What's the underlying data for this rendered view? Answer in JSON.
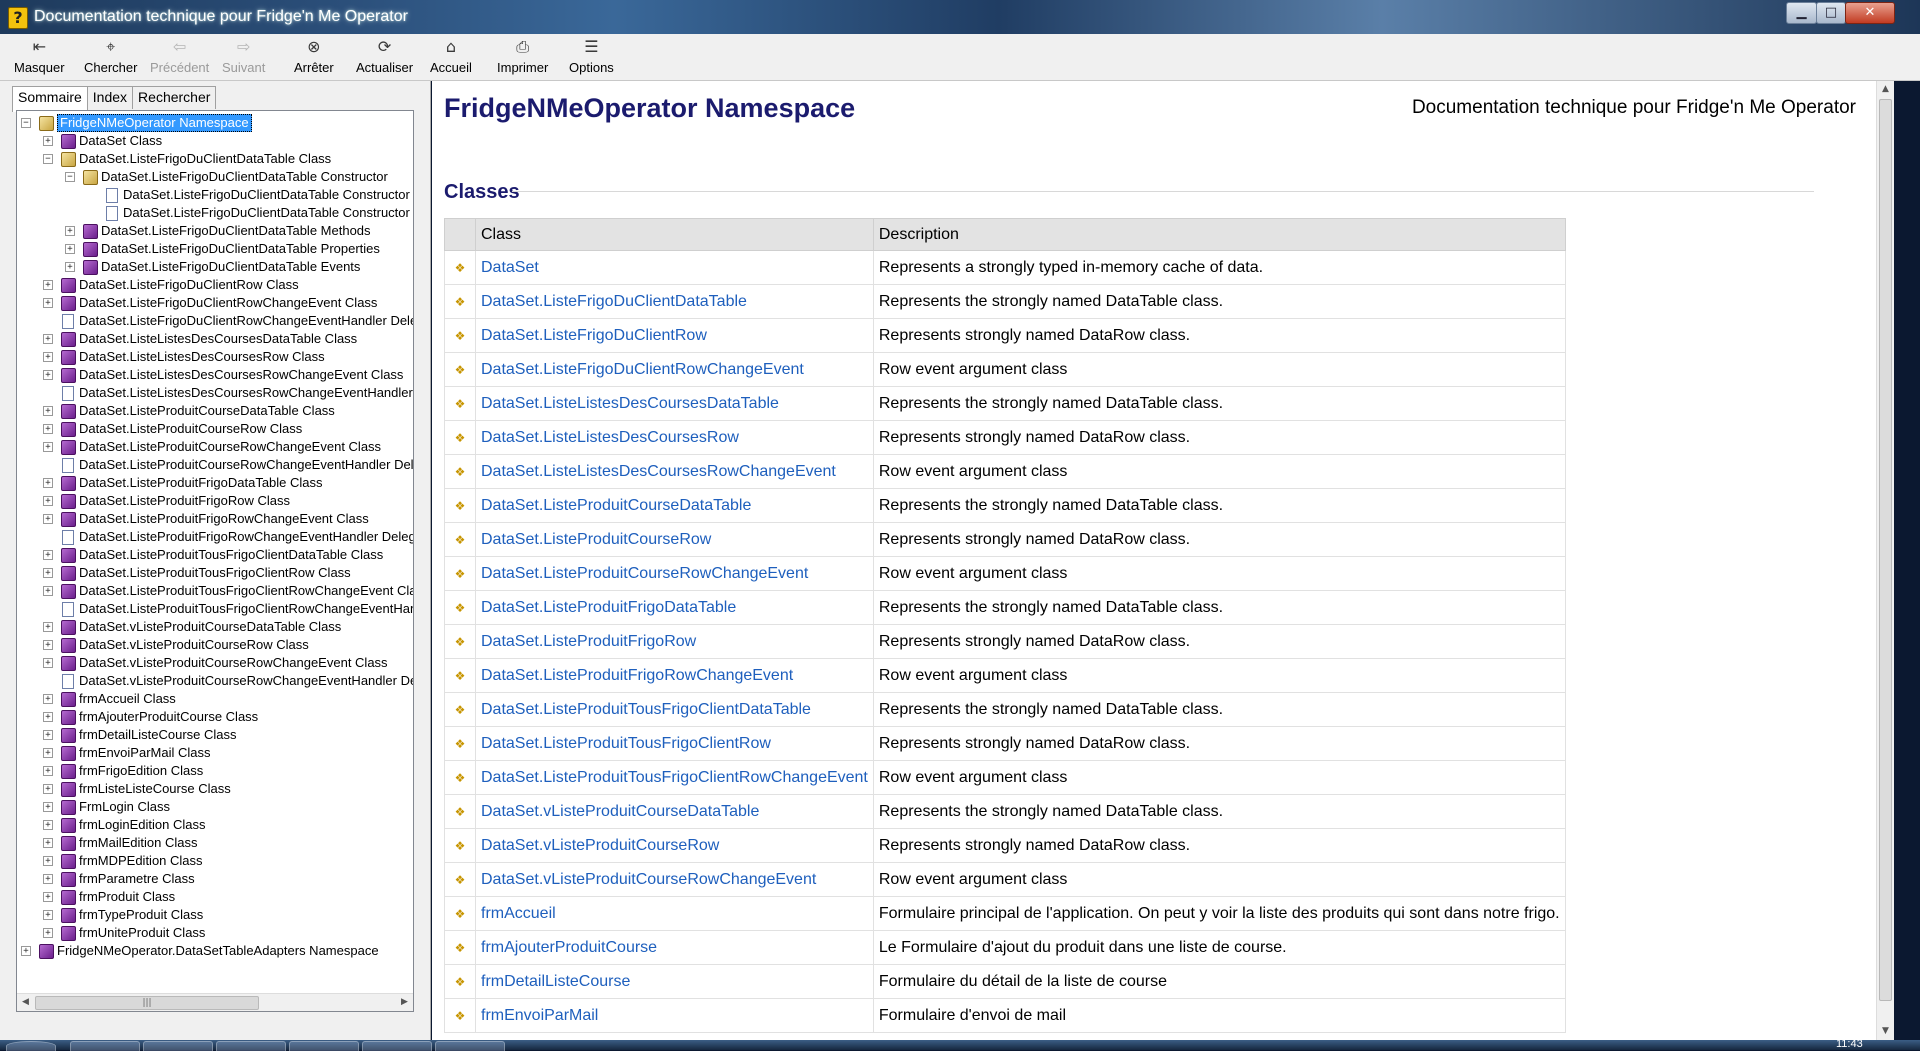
{
  "window": {
    "title": "Documentation technique pour Fridge'n Me Operator",
    "app_icon": "?",
    "controls": {
      "minimize": "▁",
      "maximize": "□",
      "close": "✕"
    }
  },
  "toolbar": {
    "buttons": [
      {
        "label": "Masquer",
        "icon": "hide-pane-icon",
        "glyph": "⇤",
        "enabled": true
      },
      {
        "label": "Chercher",
        "icon": "locate-icon",
        "glyph": "⌖",
        "enabled": true
      },
      {
        "label": "Précédent",
        "icon": "back-arrow-icon",
        "glyph": "⇦",
        "enabled": false
      },
      {
        "label": "Suivant",
        "icon": "forward-arrow-icon",
        "glyph": "⇨",
        "enabled": false
      },
      {
        "label": "Arrêter",
        "icon": "stop-icon",
        "glyph": "⊗",
        "enabled": true
      },
      {
        "label": "Actualiser",
        "icon": "refresh-icon",
        "glyph": "⟳",
        "enabled": true
      },
      {
        "label": "Accueil",
        "icon": "home-icon",
        "glyph": "⌂",
        "enabled": true
      },
      {
        "label": "Imprimer",
        "icon": "printer-icon",
        "glyph": "⎙",
        "enabled": true
      },
      {
        "label": "Options",
        "icon": "options-icon",
        "glyph": "☰",
        "enabled": true
      }
    ]
  },
  "left_panel": {
    "tabs": [
      {
        "label": "Sommaire",
        "active": true
      },
      {
        "label": "Index",
        "active": false
      },
      {
        "label": "Rechercher",
        "active": false
      }
    ],
    "tree": [
      {
        "label": "FridgeNMeOperator Namespace",
        "level": 0,
        "toggle": "−",
        "icon": "book-open",
        "selected": true
      },
      {
        "label": "DataSet Class",
        "level": 1,
        "toggle": "+",
        "icon": "book"
      },
      {
        "label": "DataSet.ListeFrigoDuClientDataTable Class",
        "level": 1,
        "toggle": "−",
        "icon": "book-open"
      },
      {
        "label": "DataSet.ListeFrigoDuClientDataTable Constructor",
        "level": 2,
        "toggle": "−",
        "icon": "book-open"
      },
      {
        "label": "DataSet.ListeFrigoDuClientDataTable Constructor",
        "level": 3,
        "toggle": "",
        "icon": "page"
      },
      {
        "label": "DataSet.ListeFrigoDuClientDataTable Constructor",
        "level": 3,
        "toggle": "",
        "icon": "page"
      },
      {
        "label": "DataSet.ListeFrigoDuClientDataTable Methods",
        "level": 2,
        "toggle": "+",
        "icon": "book"
      },
      {
        "label": "DataSet.ListeFrigoDuClientDataTable Properties",
        "level": 2,
        "toggle": "+",
        "icon": "book"
      },
      {
        "label": "DataSet.ListeFrigoDuClientDataTable Events",
        "level": 2,
        "toggle": "+",
        "icon": "book"
      },
      {
        "label": "DataSet.ListeFrigoDuClientRow Class",
        "level": 1,
        "toggle": "+",
        "icon": "book"
      },
      {
        "label": "DataSet.ListeFrigoDuClientRowChangeEvent Class",
        "level": 1,
        "toggle": "+",
        "icon": "book"
      },
      {
        "label": "DataSet.ListeFrigoDuClientRowChangeEventHandler Delegate",
        "level": 1,
        "toggle": "",
        "icon": "page"
      },
      {
        "label": "DataSet.ListeListesDesCoursesDataTable Class",
        "level": 1,
        "toggle": "+",
        "icon": "book"
      },
      {
        "label": "DataSet.ListeListesDesCoursesRow Class",
        "level": 1,
        "toggle": "+",
        "icon": "book"
      },
      {
        "label": "DataSet.ListeListesDesCoursesRowChangeEvent Class",
        "level": 1,
        "toggle": "+",
        "icon": "book"
      },
      {
        "label": "DataSet.ListeListesDesCoursesRowChangeEventHandler Delegate",
        "level": 1,
        "toggle": "",
        "icon": "page"
      },
      {
        "label": "DataSet.ListeProduitCourseDataTable Class",
        "level": 1,
        "toggle": "+",
        "icon": "book"
      },
      {
        "label": "DataSet.ListeProduitCourseRow Class",
        "level": 1,
        "toggle": "+",
        "icon": "book"
      },
      {
        "label": "DataSet.ListeProduitCourseRowChangeEvent Class",
        "level": 1,
        "toggle": "+",
        "icon": "book"
      },
      {
        "label": "DataSet.ListeProduitCourseRowChangeEventHandler Delegate",
        "level": 1,
        "toggle": "",
        "icon": "page"
      },
      {
        "label": "DataSet.ListeProduitFrigoDataTable Class",
        "level": 1,
        "toggle": "+",
        "icon": "book"
      },
      {
        "label": "DataSet.ListeProduitFrigoRow Class",
        "level": 1,
        "toggle": "+",
        "icon": "book"
      },
      {
        "label": "DataSet.ListeProduitFrigoRowChangeEvent Class",
        "level": 1,
        "toggle": "+",
        "icon": "book"
      },
      {
        "label": "DataSet.ListeProduitFrigoRowChangeEventHandler Delegate",
        "level": 1,
        "toggle": "",
        "icon": "page"
      },
      {
        "label": "DataSet.ListeProduitTousFrigoClientDataTable Class",
        "level": 1,
        "toggle": "+",
        "icon": "book"
      },
      {
        "label": "DataSet.ListeProduitTousFrigoClientRow Class",
        "level": 1,
        "toggle": "+",
        "icon": "book"
      },
      {
        "label": "DataSet.ListeProduitTousFrigoClientRowChangeEvent Class",
        "level": 1,
        "toggle": "+",
        "icon": "book"
      },
      {
        "label": "DataSet.ListeProduitTousFrigoClientRowChangeEventHandler Delegate",
        "level": 1,
        "toggle": "",
        "icon": "page"
      },
      {
        "label": "DataSet.vListeProduitCourseDataTable Class",
        "level": 1,
        "toggle": "+",
        "icon": "book"
      },
      {
        "label": "DataSet.vListeProduitCourseRow Class",
        "level": 1,
        "toggle": "+",
        "icon": "book"
      },
      {
        "label": "DataSet.vListeProduitCourseRowChangeEvent Class",
        "level": 1,
        "toggle": "+",
        "icon": "book"
      },
      {
        "label": "DataSet.vListeProduitCourseRowChangeEventHandler Delegate",
        "level": 1,
        "toggle": "",
        "icon": "page"
      },
      {
        "label": "frmAccueil Class",
        "level": 1,
        "toggle": "+",
        "icon": "book"
      },
      {
        "label": "frmAjouterProduitCourse Class",
        "level": 1,
        "toggle": "+",
        "icon": "book"
      },
      {
        "label": "frmDetailListeCourse Class",
        "level": 1,
        "toggle": "+",
        "icon": "book"
      },
      {
        "label": "frmEnvoiParMail Class",
        "level": 1,
        "toggle": "+",
        "icon": "book"
      },
      {
        "label": "frmFrigoEdition Class",
        "level": 1,
        "toggle": "+",
        "icon": "book"
      },
      {
        "label": "frmListeListeCourse Class",
        "level": 1,
        "toggle": "+",
        "icon": "book"
      },
      {
        "label": "FrmLogin Class",
        "level": 1,
        "toggle": "+",
        "icon": "book"
      },
      {
        "label": "frmLoginEdition Class",
        "level": 1,
        "toggle": "+",
        "icon": "book"
      },
      {
        "label": "frmMailEdition Class",
        "level": 1,
        "toggle": "+",
        "icon": "book"
      },
      {
        "label": "frmMDPEdition Class",
        "level": 1,
        "toggle": "+",
        "icon": "book"
      },
      {
        "label": "frmParametre Class",
        "level": 1,
        "toggle": "+",
        "icon": "book"
      },
      {
        "label": "frmProduit Class",
        "level": 1,
        "toggle": "+",
        "icon": "book"
      },
      {
        "label": "frmTypeProduit Class",
        "level": 1,
        "toggle": "+",
        "icon": "book"
      },
      {
        "label": "frmUniteProduit Class",
        "level": 1,
        "toggle": "+",
        "icon": "book"
      },
      {
        "label": "FridgeNMeOperator.DataSetTableAdapters Namespace",
        "level": 0,
        "toggle": "+",
        "icon": "book"
      }
    ],
    "scrollbar": {
      "left_arrow": "◀",
      "right_arrow": "▶",
      "grip": "|||"
    }
  },
  "content": {
    "page_title": "FridgeNMeOperator Namespace",
    "doc_title": "Documentation technique pour Fridge'n Me Operator",
    "section_title": "Classes",
    "table": {
      "headers": [
        "Class",
        "Description"
      ],
      "row_icon": "class-icon",
      "row_glyph": "❖",
      "rows": [
        {
          "name": "DataSet",
          "description": "Represents a strongly typed in-memory cache of data."
        },
        {
          "name": "DataSet.ListeFrigoDuClientDataTable",
          "description": "Represents the strongly named DataTable class."
        },
        {
          "name": "DataSet.ListeFrigoDuClientRow",
          "description": "Represents strongly named DataRow class."
        },
        {
          "name": "DataSet.ListeFrigoDuClientRowChangeEvent",
          "description": "Row event argument class"
        },
        {
          "name": "DataSet.ListeListesDesCoursesDataTable",
          "description": "Represents the strongly named DataTable class."
        },
        {
          "name": "DataSet.ListeListesDesCoursesRow",
          "description": "Represents strongly named DataRow class."
        },
        {
          "name": "DataSet.ListeListesDesCoursesRowChangeEvent",
          "description": "Row event argument class"
        },
        {
          "name": "DataSet.ListeProduitCourseDataTable",
          "description": "Represents the strongly named DataTable class."
        },
        {
          "name": "DataSet.ListeProduitCourseRow",
          "description": "Represents strongly named DataRow class."
        },
        {
          "name": "DataSet.ListeProduitCourseRowChangeEvent",
          "description": "Row event argument class"
        },
        {
          "name": "DataSet.ListeProduitFrigoDataTable",
          "description": "Represents the strongly named DataTable class."
        },
        {
          "name": "DataSet.ListeProduitFrigoRow",
          "description": "Represents strongly named DataRow class."
        },
        {
          "name": "DataSet.ListeProduitFrigoRowChangeEvent",
          "description": "Row event argument class"
        },
        {
          "name": "DataSet.ListeProduitTousFrigoClientDataTable",
          "description": "Represents the strongly named DataTable class."
        },
        {
          "name": "DataSet.ListeProduitTousFrigoClientRow",
          "description": "Represents strongly named DataRow class."
        },
        {
          "name": "DataSet.ListeProduitTousFrigoClientRowChangeEvent",
          "description": "Row event argument class"
        },
        {
          "name": "DataSet.vListeProduitCourseDataTable",
          "description": "Represents the strongly named DataTable class."
        },
        {
          "name": "DataSet.vListeProduitCourseRow",
          "description": "Represents strongly named DataRow class."
        },
        {
          "name": "DataSet.vListeProduitCourseRowChangeEvent",
          "description": "Row event argument class"
        },
        {
          "name": "frmAccueil",
          "description": "Formulaire principal de l'application. On peut y voir la liste des produits qui sont dans notre frigo."
        },
        {
          "name": "frmAjouterProduitCourse",
          "description": "Le Formulaire d'ajout du produit dans une liste de course."
        },
        {
          "name": "frmDetailListeCourse",
          "description": "Formulaire du détail de la liste de course"
        },
        {
          "name": "frmEnvoiParMail",
          "description": "Formulaire d'envoi de mail"
        }
      ]
    },
    "scrollbar": {
      "up_arrow": "▲",
      "down_arrow": "▼"
    }
  },
  "taskbar": {
    "clock": "11:43"
  },
  "colors": {
    "link": "#1e5fbd",
    "heading": "#1b1b6e",
    "selection": "#3399ff",
    "book": "#7a2a9e"
  }
}
